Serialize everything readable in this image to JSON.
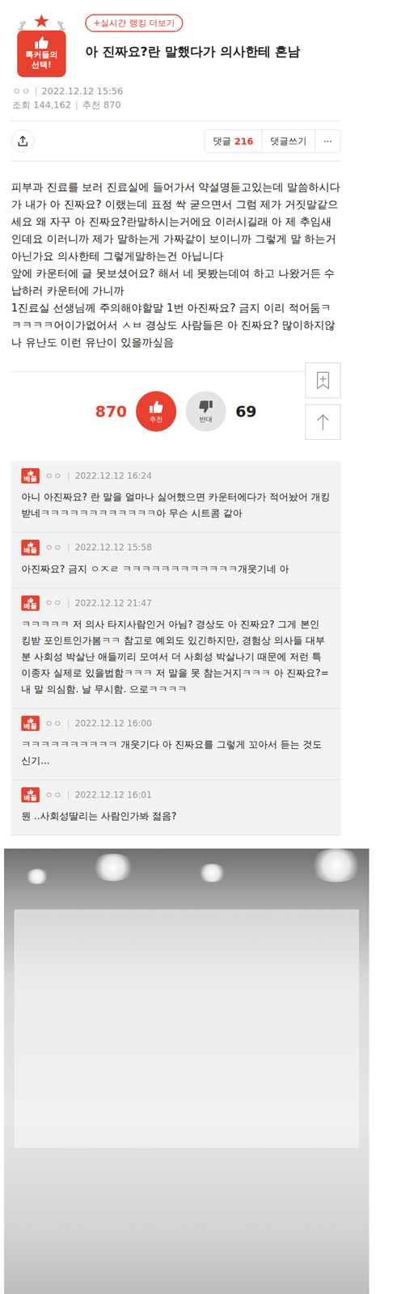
{
  "badge": "톡커들의 선택!",
  "ranking_link": "+실시간 랭킹 더보기",
  "post": {
    "title": "아 진짜요?란 말했다가 의사한테 혼남",
    "author": "ㅇㅇ",
    "date": "2022.12.12 15:56",
    "views_label": "조회",
    "views": "144,162",
    "likes_label": "추천",
    "likes": "870"
  },
  "toolbar": {
    "comments_label": "댓글",
    "comments_count": "216",
    "write": "댓글쓰기",
    "more": "···"
  },
  "body": [
    "피부과 진료를 보러 진료실에 들어가서 약설명듣고있는데 말씀하시다가 내가 아 진짜요? 이랬는데 표정 싹 굳으면서 그럼 제가 거짓말같으세요 왜 자꾸 아 진짜요?란말하시는거에요 이러시길래 아 제 추임새인데요 이러니까 제가 말하는게 가짜같이 보이니까 그렇게 말 하는거 아닌가요 의사한테 그렇게말하는건 아닙니다",
    "앞에 카운터에 글 못보셨어요? 해서 네 못봤는데여 하고 나왔거든 수납하러 카운터에 가니까",
    "1진료실 선생님께 주의해야할말 1번 아진짜요? 금지 이리 적어둠ㅋㅋㅋㅋㅋ어이가없어서 ㅅㅂ 경상도 사람들은 아 진짜요? 많이하지않나 유난도 이런 유난이 있을까싶음"
  ],
  "votes": {
    "up_count": "870",
    "up_label": "추천",
    "down_label": "반대",
    "down_count": "69"
  },
  "comments": [
    {
      "badge": "베플",
      "author": "ㅇㅇ",
      "date": "2022.12.12 16:24",
      "text": "아니 아진짜요? 란 말을 얼마나 싫어했으면 카운터에다가 적어놨어 개킹받네ㅋㅋㅋㅋㅋㅋㅋㅋㅋㅋㅋㅋ아 무슨 시트콤 같아"
    },
    {
      "badge": "베플",
      "author": "ㅇㅇ",
      "date": "2022.12.12 15:58",
      "text": "아진짜요? 금지 ㅇㅈㄹ ㅋㅋㅋㅋㅋㅋㅋㅋㅋㅋㅋㅋ개웃기네 아"
    },
    {
      "badge": "베플",
      "author": "ㅇㅇ",
      "date": "2022.12.12 21:47",
      "text": "ㅋㅋㅋㅋㅋ 저 의사 타지사람인거 아님? 경상도 아 진짜요? 그게 본인 킹받 포인트인가봄ㅋㅋ 참고로 예외도 있긴하지만, 경험상 의사들 대부분 사회성 박살난 애들끼리 모여서 더 사회성 박살나기 때문에 저런 특이종자 실제로 있을법함ㅋㅋㅋ 저 말을 못 참는거지ㅋㅋㅋ 아 진짜요?= 내 말 의심함. 날 무시함. 으로ㅋㅋㅋㅋ"
    },
    {
      "badge": "베플",
      "author": "ㅇㅇ",
      "date": "2022.12.12 16:00",
      "text": "ㅋㅋㅋㅋㅋㅋㅋㅋㅋㅋ 개웃기다 아 진짜요를 그렇게 꼬아서 듣는 것도 신기..."
    },
    {
      "badge": "베플",
      "author": "ㅇㅇ",
      "date": "2022.12.12 16:01",
      "text": "뭔 ..사회성딸리는 사람인가봐 젊음?"
    }
  ]
}
